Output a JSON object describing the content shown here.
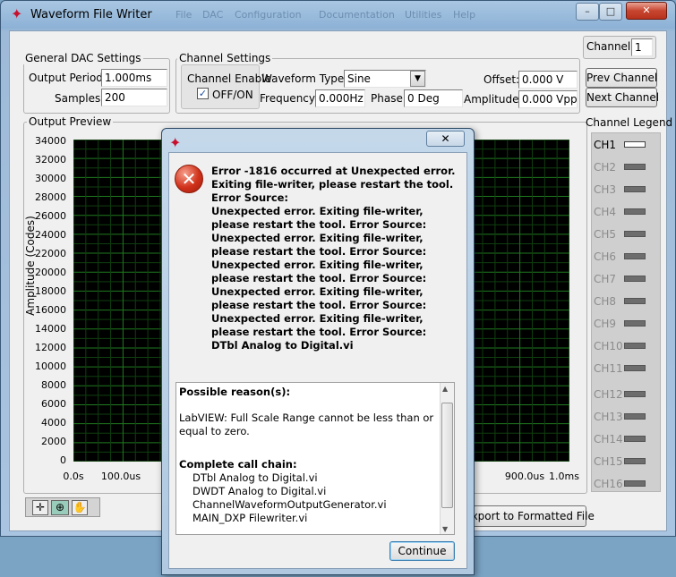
{
  "window": {
    "title": "Waveform File Writer",
    "menu": [
      "File",
      "DAC",
      "Configuration",
      "Documentation",
      "Utilities",
      "Help"
    ]
  },
  "general_dac": {
    "title": "General DAC Settings",
    "output_period_label": "Output Period:",
    "output_period_value": "1.000ms",
    "samples_label": "Samples:",
    "samples_value": "200"
  },
  "channel_settings": {
    "title": "Channel Settings",
    "channel_enable_label": "Channel Enable",
    "enable_checkbox_label": "OFF/ON",
    "waveform_type_label": "Waveform Type:",
    "waveform_type_value": "Sine",
    "frequency_label": "Frequency:",
    "frequency_value": "0.000Hz",
    "phase_label": "Phase:",
    "phase_value": "0 Deg",
    "offset_label": "Offset:",
    "offset_value": "0.000 V",
    "amplitude_label": "Amplitude:",
    "amplitude_value": "0.000 Vpp"
  },
  "channel_nav": {
    "channel_label": "Channel:",
    "channel_value": "1",
    "prev_label": "Prev Channel",
    "next_label": "Next Channel"
  },
  "output_preview": {
    "title": "Output Preview",
    "ylabel": "Amplitude (Codes)",
    "yticks": [
      "34000",
      "32000",
      "30000",
      "28000",
      "26000",
      "24000",
      "22000",
      "20000",
      "18000",
      "16000",
      "14000",
      "12000",
      "10000",
      "8000",
      "6000",
      "4000",
      "2000",
      "0"
    ],
    "xticks": [
      "0.0s",
      "100.0us",
      "900.0us",
      "1.0ms"
    ]
  },
  "legend": {
    "title": "Channel Legend",
    "items": [
      "CH1",
      "CH2",
      "CH3",
      "CH4",
      "CH5",
      "CH6",
      "CH7",
      "CH8",
      "CH9",
      "CH10",
      "CH11",
      "CH12",
      "CH13",
      "CH14",
      "CH15",
      "CH16"
    ]
  },
  "export_label": "Export to Formatted File",
  "dialog": {
    "message": "Error -1816 occurred at Unexpected error. Exiting file-writer, please restart the tool. Error Source:\nUnexpected error. Exiting file-writer, please restart the tool. Error Source:\nUnexpected error. Exiting file-writer, please restart the tool. Error Source:\nUnexpected error. Exiting file-writer, please restart the tool. Error Source:\nUnexpected error. Exiting file-writer, please restart the tool. Error Source:\nUnexpected error. Exiting file-writer, please restart the tool. Error Source:\nDTbl Analog to Digital.vi",
    "possible_reasons_title": "Possible reason(s):",
    "reason_text": "LabVIEW:  Full Scale Range cannot be less than or equal to zero.",
    "call_chain_title": "Complete call chain:",
    "call_chain": [
      "DTbl Analog to Digital.vi",
      "DWDT Analog to Digital.vi",
      "ChannelWaveformOutputGenerator.vi",
      "MAIN_DXP Filewriter.vi"
    ],
    "continue_label": "Continue"
  }
}
